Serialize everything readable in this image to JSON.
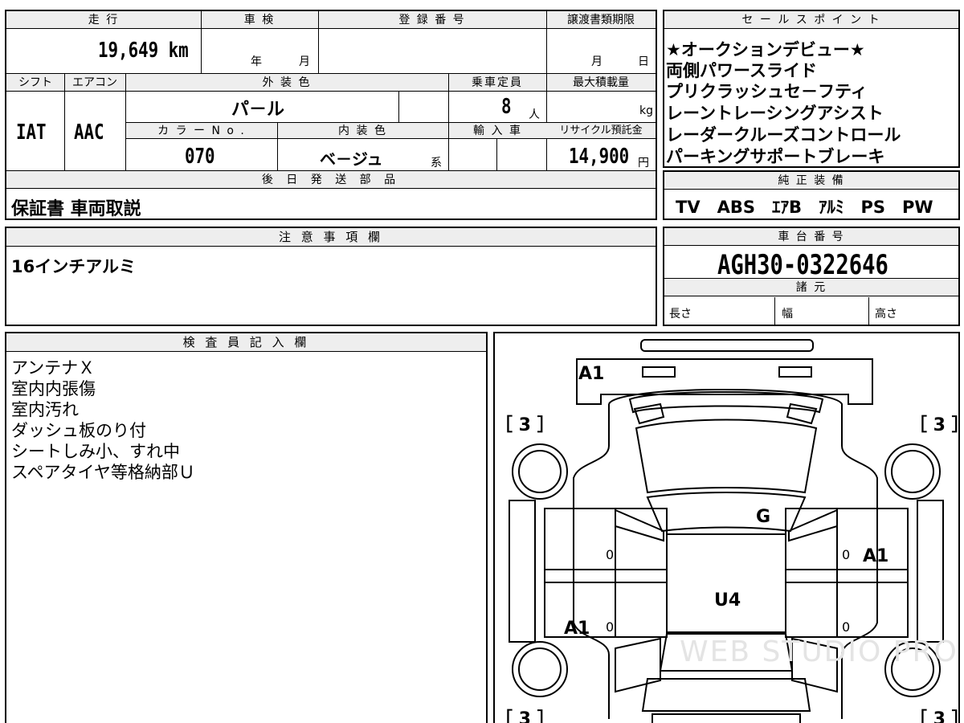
{
  "left_top": {
    "headers": {
      "mileage": "走 行",
      "inspection": "車 検",
      "registration": "登 録 番 号",
      "transfer_deadline": "譲渡書類期限"
    },
    "mileage_value": "19,649 km",
    "inspection_year": "年",
    "inspection_month": "月",
    "transfer_month": "月",
    "transfer_day": "日",
    "headers2": {
      "shift": "シフト",
      "aircon": "エアコン",
      "exterior_color": "外 装 色",
      "capacity": "乗車定員",
      "max_load": "最大積載量"
    },
    "shift_value": "IAT",
    "aircon_value": "AAC",
    "exterior_color_value": "パ－ル",
    "capacity_value": "8",
    "capacity_unit": "人",
    "max_load_unit": "kg",
    "headers3": {
      "color_no": "カ ラ ー N o .",
      "interior_color": "内 装 色",
      "import": "輸 入 車",
      "recycle_fee": "リサイクル預託金"
    },
    "color_no_value": "070",
    "interior_color_value": "ベ－ジュ",
    "interior_color_suffix": "系",
    "recycle_fee_value": "14,900",
    "recycle_fee_unit": "円",
    "later_parts_header": "後 日 発 送 部 品",
    "later_parts_value": "保証書 車両取説"
  },
  "sales_points": {
    "header": "セ ー ル ス ポ イ ン ト",
    "items": [
      "★オークションデビュー★",
      "両側パワースライド",
      "プリクラッシュセ－フティ",
      "レーントレーシングアシスト",
      "レーダークルーズコントロール",
      "パーキングサポートブレーキ"
    ]
  },
  "genuine_equipment": {
    "header": "純 正 装 備",
    "value": "TV　ABS　ｴｱB　ｱﾙﾐ　PS　PW"
  },
  "notes": {
    "header": "注 意 事 項 欄",
    "value": "16インチアルミ"
  },
  "chassis": {
    "header": "車 台 番 号",
    "value": "AGH30-0322646",
    "specs_header": "諸 元",
    "length": "長さ",
    "width": "幅",
    "height": "高さ"
  },
  "inspector": {
    "header": "検 査 員 記 入 欄",
    "items": [
      "アンテナＸ",
      "室内内張傷",
      "室内汚れ",
      "ダッシュ板のり付",
      "シートしみ小、すれ中",
      "スペアタイヤ等格納部Ｕ"
    ]
  },
  "diagram": {
    "marks": {
      "front_bumper": "A1",
      "hood": "G",
      "roof": "U4",
      "right_rear_door": "A1",
      "left_rear_door": "A1"
    },
    "door_zeros": [
      "0",
      "0",
      "0",
      "0"
    ],
    "tire_bracket": "［ 3 ］",
    "watermark": "WEB STUDIO PRO"
  }
}
